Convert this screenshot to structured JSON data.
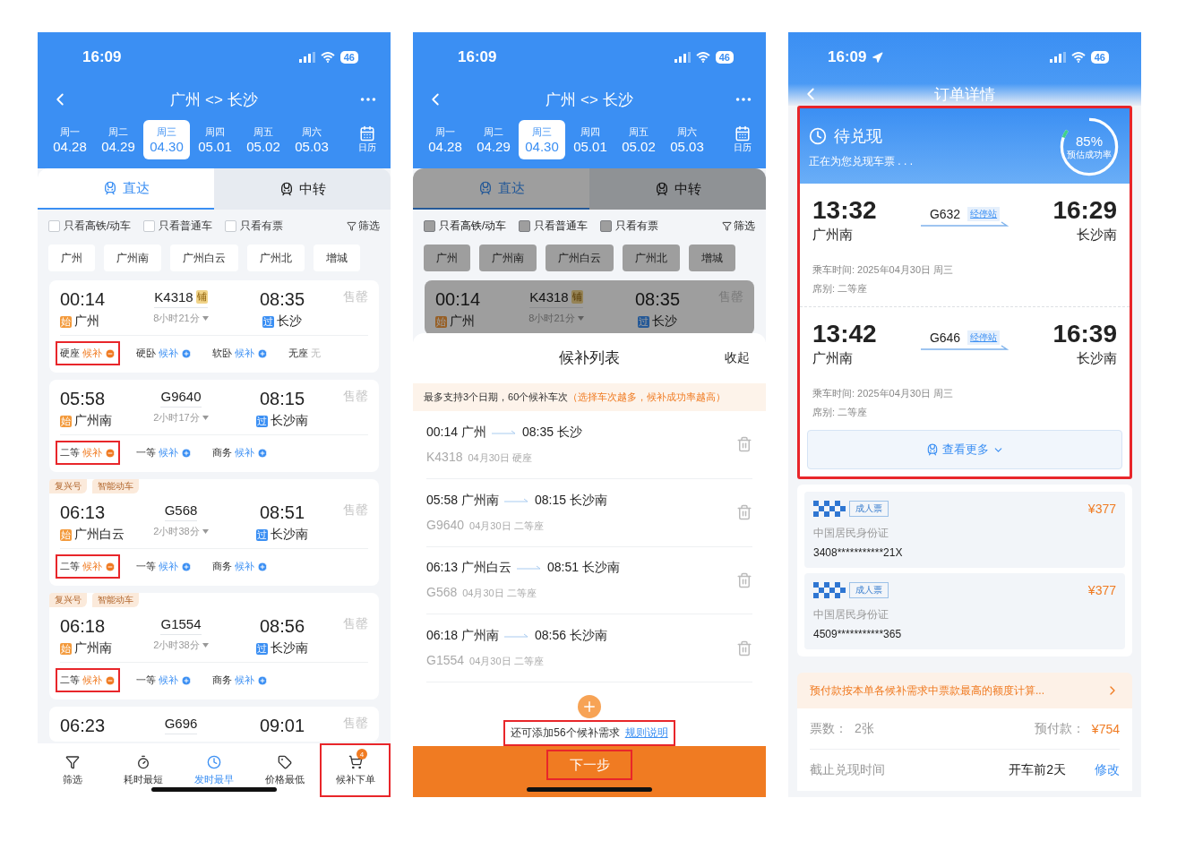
{
  "screens": [
    {
      "kind": "search",
      "status": {
        "time": "16:09",
        "battery": "46"
      },
      "title": "广州 <> 长沙",
      "dates": [
        {
          "weekday": "周一",
          "date": "04.28",
          "selected": false
        },
        {
          "weekday": "周二",
          "date": "04.29",
          "selected": false
        },
        {
          "weekday": "周三",
          "date": "04.30",
          "selected": true
        },
        {
          "weekday": "周四",
          "date": "05.01",
          "selected": false
        },
        {
          "weekday": "周五",
          "date": "05.02",
          "selected": false
        },
        {
          "weekday": "周六",
          "date": "05.03",
          "selected": false
        }
      ],
      "calendar_label": "日历",
      "dimmed": false,
      "modes": [
        {
          "label": "直达",
          "selected": true
        },
        {
          "label": "中转",
          "selected": false
        }
      ],
      "filters": [
        {
          "label": "只看高铁/动车",
          "checked": false
        },
        {
          "label": "只看普通车",
          "checked": false
        },
        {
          "label": "只看有票",
          "checked": false
        }
      ],
      "filter_button": "筛选",
      "stations": [
        "广州",
        "广州南",
        "广州白云",
        "广州北",
        "增城"
      ],
      "trains": [
        {
          "depart": "00:14",
          "from_badge": "始",
          "from": "广州",
          "number": "K4318",
          "number_badge": "铺",
          "duration": "8小时21分",
          "arrive": "08:35",
          "to_badge": "过",
          "to": "长沙",
          "status": "售罄",
          "seats": [
            {
              "kind": "waitlist",
              "seat": "硬座",
              "action": "候补",
              "added": true,
              "highlighted": true
            },
            {
              "kind": "waitlist",
              "seat": "硬卧",
              "action": "候补",
              "added": false,
              "highlighted": false
            },
            {
              "kind": "waitlist",
              "seat": "软卧",
              "action": "候补",
              "added": false,
              "highlighted": false
            },
            {
              "kind": "none",
              "seat": "无座",
              "action": "无",
              "highlighted": false
            }
          ]
        },
        {
          "depart": "05:58",
          "from_badge": "始",
          "from": "广州南",
          "number": "G9640",
          "duration": "2小时17分",
          "arrive": "08:15",
          "to_badge": "过",
          "to": "长沙南",
          "status": "售罄",
          "seats": [
            {
              "kind": "waitlist",
              "seat": "二等",
              "action": "候补",
              "added": true,
              "highlighted": true
            },
            {
              "kind": "waitlist",
              "seat": "一等",
              "action": "候补",
              "added": false,
              "highlighted": false
            },
            {
              "kind": "waitlist",
              "seat": "商务",
              "action": "候补",
              "added": false,
              "highlighted": false
            }
          ]
        },
        {
          "tags": [
            "复兴号",
            "智能动车"
          ],
          "depart": "06:13",
          "from_badge": "始",
          "from": "广州白云",
          "number": "G568",
          "duration": "2小时38分",
          "arrive": "08:51",
          "to_badge": "过",
          "to": "长沙南",
          "status": "售罄",
          "seats": [
            {
              "kind": "waitlist",
              "seat": "二等",
              "action": "候补",
              "added": true,
              "highlighted": true
            },
            {
              "kind": "waitlist",
              "seat": "一等",
              "action": "候补",
              "added": false,
              "highlighted": false
            },
            {
              "kind": "waitlist",
              "seat": "商务",
              "action": "候补",
              "added": false,
              "highlighted": false
            }
          ]
        },
        {
          "tags": [
            "复兴号",
            "智能动车"
          ],
          "depart": "06:18",
          "from_badge": "始",
          "from": "广州南",
          "number": "G1554",
          "duration": "2小时38分",
          "arrive": "08:56",
          "to_badge": "过",
          "to": "长沙南",
          "status": "售罄",
          "seats": [
            {
              "kind": "waitlist",
              "seat": "二等",
              "action": "候补",
              "added": true,
              "highlighted": true
            },
            {
              "kind": "waitlist",
              "seat": "一等",
              "action": "候补",
              "added": false,
              "highlighted": false
            },
            {
              "kind": "waitlist",
              "seat": "商务",
              "action": "候补",
              "added": false,
              "highlighted": false
            }
          ]
        },
        {
          "depart": "06:23",
          "number": "G696",
          "arrive": "09:01",
          "status": "售罄"
        }
      ],
      "bottom_nav": [
        {
          "kind": "filter",
          "label": "筛选",
          "selected": false,
          "highlighted": false
        },
        {
          "kind": "duration",
          "label": "耗时最短",
          "selected": false,
          "highlighted": false
        },
        {
          "kind": "earliest",
          "label": "发时最早",
          "selected": true,
          "highlighted": false
        },
        {
          "kind": "price",
          "label": "价格最低",
          "selected": false,
          "highlighted": false
        },
        {
          "kind": "cart",
          "label": "候补下单",
          "badge": "4",
          "selected": false,
          "highlighted": true
        }
      ]
    },
    {
      "kind": "waitlist",
      "status": {
        "time": "16:09",
        "battery": "46"
      },
      "title": "广州 <> 长沙",
      "dates": [
        {
          "weekday": "周一",
          "date": "04.28",
          "selected": false
        },
        {
          "weekday": "周二",
          "date": "04.29",
          "selected": false
        },
        {
          "weekday": "周三",
          "date": "04.30",
          "selected": true
        },
        {
          "weekday": "周四",
          "date": "05.01",
          "selected": false
        },
        {
          "weekday": "周五",
          "date": "05.02",
          "selected": false
        },
        {
          "weekday": "周六",
          "date": "05.03",
          "selected": false
        }
      ],
      "calendar_label": "日历",
      "dimmed": true,
      "modes": [
        {
          "label": "直达",
          "selected": true
        },
        {
          "label": "中转",
          "selected": false
        }
      ],
      "filters": [
        {
          "label": "只看高铁/动车",
          "checked": false
        },
        {
          "label": "只看普通车",
          "checked": false
        },
        {
          "label": "只看有票",
          "checked": false
        }
      ],
      "filter_button": "筛选",
      "stations": [
        "广州",
        "广州南",
        "广州白云",
        "广州北",
        "增城"
      ],
      "trains": [
        {
          "depart": "00:14",
          "from_badge": "始",
          "from": "广州",
          "number": "K4318",
          "number_badge": "铺",
          "duration": "8小时21分",
          "arrive": "08:35",
          "to_badge": "过",
          "to": "长沙",
          "status": "售罄"
        }
      ],
      "sheet": {
        "title": "候补列表",
        "close": "收起",
        "notice": "最多支持3个日期，60个候补车次",
        "notice_hint": "（选择车次越多，候补成功率越高）",
        "items": [
          {
            "depart": "00:14",
            "from": "广州",
            "arrive": "08:35",
            "to": "长沙",
            "number": "K4318",
            "date": "04月30日",
            "seat": "硬座"
          },
          {
            "depart": "05:58",
            "from": "广州南",
            "arrive": "08:15",
            "to": "长沙南",
            "number": "G9640",
            "date": "04月30日",
            "seat": "二等座"
          },
          {
            "depart": "06:13",
            "from": "广州白云",
            "arrive": "08:51",
            "to": "长沙南",
            "number": "G568",
            "date": "04月30日",
            "seat": "二等座"
          },
          {
            "depart": "06:18",
            "from": "广州南",
            "arrive": "08:56",
            "to": "长沙南",
            "number": "G1554",
            "date": "04月30日",
            "seat": "二等座"
          }
        ],
        "remaining": "还可添加56个候补需求",
        "rules_link": "规则说明",
        "remaining_highlighted": true,
        "next_button": "下一步",
        "next_highlighted": true
      }
    },
    {
      "kind": "order",
      "status": {
        "time": "16:09",
        "battery": "46",
        "location": true
      },
      "title": "订单详情",
      "order": {
        "highlighted": true,
        "state": "待兑现",
        "message": "正在为您兑现车票 . . .",
        "rate": "85%",
        "rate_label": "预估成功率",
        "level": 0.85,
        "trips": [
          {
            "depart": "13:32",
            "from": "广州南",
            "number": "G632",
            "stops_link": "经停站",
            "arrive": "16:29",
            "to": "长沙南",
            "ride_time": "乘车时间: 2025年04月30日 周三",
            "seat": "席别: 二等座"
          },
          {
            "depart": "13:42",
            "from": "广州南",
            "number": "G646",
            "stops_link": "经停站",
            "arrive": "16:39",
            "to": "长沙南",
            "ride_time": "乘车时间: 2025年04月30日 周三",
            "seat": "席别: 二等座"
          }
        ],
        "more_button": "查看更多"
      },
      "passengers": [
        {
          "ticket_type": "成人票",
          "price": "¥377",
          "id_type": "中国居民身份证",
          "id_number": "3408***********21X"
        },
        {
          "ticket_type": "成人票",
          "price": "¥377",
          "id_type": "中国居民身份证",
          "id_number": "4509***********365"
        }
      ],
      "prepay_notice": "预付款按本单各候补需求中票款最高的额度计算...",
      "summary": {
        "count_label": "票数：",
        "count": "2张",
        "prepay_label": "预付款：",
        "prepay": "¥754"
      },
      "deadline": {
        "label": "截止兑现时间",
        "value": "开车前2天",
        "action": "修改"
      }
    }
  ]
}
